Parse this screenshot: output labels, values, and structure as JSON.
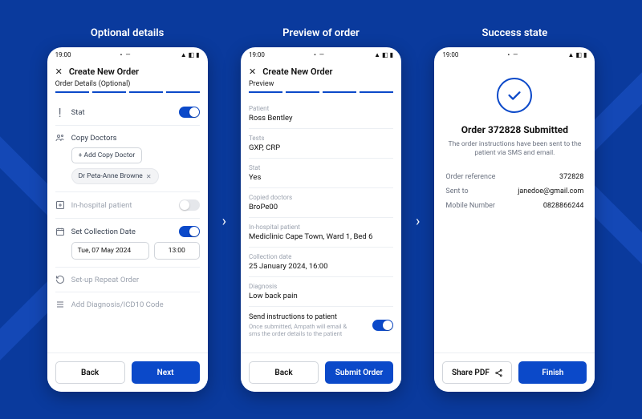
{
  "screens": {
    "optional": {
      "colLabel": "Optional details",
      "statusTime": "19:00",
      "title": "Create New Order",
      "subhead": "Order Details (Optional)",
      "stat": {
        "label": "Stat"
      },
      "copyDoctors": {
        "label": "Copy Doctors",
        "addLabel": "+  Add Copy Doctor",
        "chipLabel": "Dr Peta-Anne Browne"
      },
      "inHospital": {
        "label": "In-hospital patient"
      },
      "collection": {
        "label": "Set Collection Date",
        "date": "Tue, 07 May 2024",
        "time": "13:00"
      },
      "repeat": {
        "label": "Set-up Repeat Order"
      },
      "diagnosis": {
        "label": "Add Diagnosis/ICD10 Code"
      },
      "buttons": {
        "back": "Back",
        "next": "Next"
      }
    },
    "preview": {
      "colLabel": "Preview of order",
      "statusTime": "19:00",
      "title": "Create New Order",
      "subhead": "Preview",
      "fields": {
        "patient": {
          "label": "Patient",
          "value": "Ross Bentley"
        },
        "tests": {
          "label": "Tests",
          "value": "GXP, CRP"
        },
        "stat": {
          "label": "Stat",
          "value": "Yes"
        },
        "copied": {
          "label": "Copied doctors",
          "value": "BroPe00"
        },
        "inhosp": {
          "label": "In-hospital patient",
          "value": "Mediclinic Cape Town, Ward 1, Bed 6"
        },
        "colldate": {
          "label": "Collection date",
          "value": "25 January 2024, 16:00"
        },
        "diag": {
          "label": "Diagnosis",
          "value": "Low back pain"
        }
      },
      "send": {
        "title": "Send instructions to patient",
        "sub": "Once submitted, Ampath will email & sms the order details to the patient"
      },
      "buttons": {
        "back": "Back",
        "submit": "Submit Order"
      }
    },
    "success": {
      "colLabel": "Success state",
      "statusTime": "19:00",
      "title": "Order 372828 Submitted",
      "sub": "The order instructions have been sent to the patient via SMS and email.",
      "kv": {
        "ref": {
          "k": "Order reference",
          "v": "372828"
        },
        "sent": {
          "k": "Sent to",
          "v": "janedoe@gmail.com"
        },
        "mob": {
          "k": "Mobile Number",
          "v": "0828866244"
        }
      },
      "buttons": {
        "share": "Share PDF",
        "finish": "Finish"
      }
    }
  }
}
